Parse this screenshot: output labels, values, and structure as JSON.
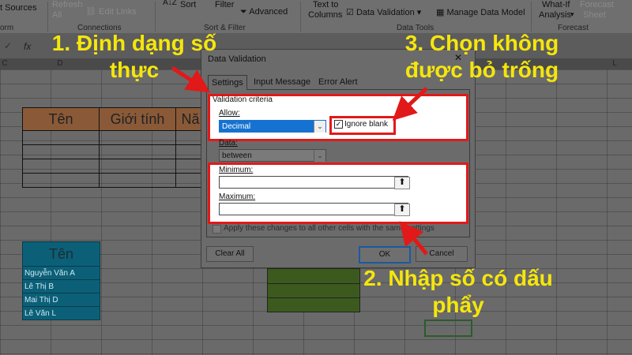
{
  "ribbon": {
    "sources": "t Sources",
    "refresh": "Refresh",
    "edit_links": "Edit Links",
    "all": "All",
    "sort": "Sort",
    "filter": "Filter",
    "advanced": "Advanced",
    "text_to": "Text to",
    "columns": "Columns",
    "data_validation": "Data Validation",
    "manage_data_model": "Manage Data Model",
    "what_if": "What-If",
    "analysis": "Analysis",
    "forecast": "Forecast",
    "sheet": "Sheet",
    "groups": {
      "form": "orm",
      "connections": "Connections",
      "sort_filter": "Sort & Filter",
      "data_tools": "Data Tools",
      "forecast": "Forecast"
    }
  },
  "formula_bar": {
    "fx": "fx"
  },
  "columns": {
    "c": "C",
    "d": "D",
    "l": "L"
  },
  "table1": {
    "headers": [
      "Tên",
      "Giới tính",
      "Nă"
    ]
  },
  "table2": {
    "header": "Tên",
    "rows": [
      "Nguyễn Văn A",
      "Lê Thị B",
      "Mai Thị D",
      "Lê Văn L"
    ]
  },
  "dialog": {
    "title": "Data Validation",
    "close": "✕",
    "tabs": [
      "Settings",
      "Input Message",
      "Error Alert"
    ],
    "validation_criteria": "Validation criteria",
    "allow_label": "Allow:",
    "allow_value": "Decimal",
    "ignore_blank": "Ignore blank",
    "data_label": "Data:",
    "data_value": "between",
    "minimum_label": "Minimum:",
    "maximum_label": "Maximum:",
    "apply_changes": "Apply these changes to all other cells with the same settings",
    "clear_all": "Clear All",
    "ok": "OK",
    "cancel": "Cancel"
  },
  "annotations": {
    "step1_line1": "1. Định dạng số",
    "step1_line2": "thực",
    "step2_line1": "2. Nhập số có dấu",
    "step2_line2": "phẩy",
    "step3_line1": "3. Chọn không",
    "step3_line2": "được bỏ trống"
  },
  "colors": {
    "highlight": "#e11919",
    "annotation_text": "#f5e60c",
    "selected_option": "#1672d0",
    "table_header_brown": "#8a5a38",
    "table_teal": "#0b6078"
  }
}
